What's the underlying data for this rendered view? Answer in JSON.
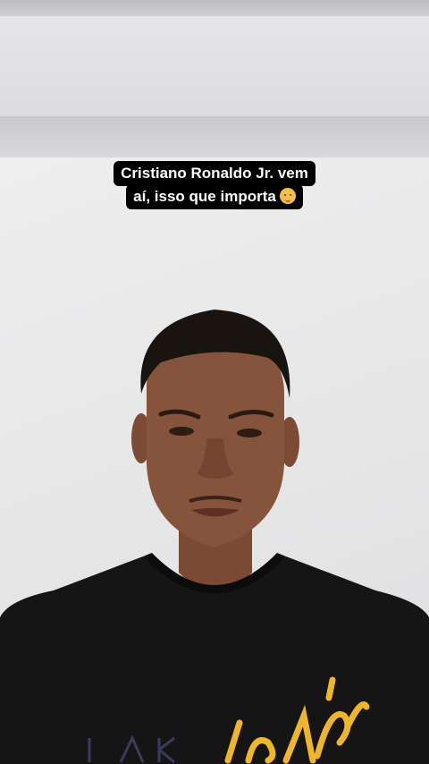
{
  "caption": {
    "line1": "Cristiano Ronaldo Jr. vem",
    "line2": "aí, isso que importa",
    "emoji": "baby-emoji"
  },
  "colors": {
    "caption_bg": "#000000",
    "caption_text": "#ffffff",
    "wall": "#e9e9ea",
    "shirt": "#151515",
    "shirt_print": "#f0b62a"
  }
}
